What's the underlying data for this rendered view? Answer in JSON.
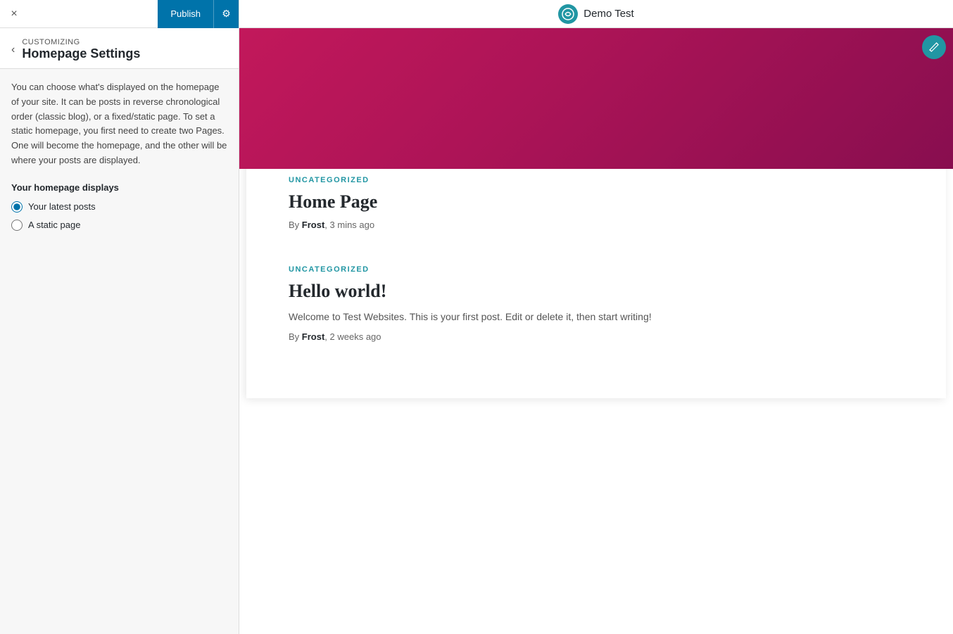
{
  "topbar": {
    "close_label": "×",
    "publish_label": "Publish",
    "settings_icon": "⚙"
  },
  "header": {
    "customizing_label": "Customizing",
    "section_title": "Homepage Settings",
    "back_icon": "‹"
  },
  "panel": {
    "description": "You can choose what's displayed on the homepage of your site. It can be posts in reverse chronological order (classic blog), or a fixed/static page. To set a static homepage, you first need to create two Pages. One will become the homepage, and the other will be where your posts are displayed.",
    "your_homepage_displays_label": "Your homepage displays",
    "options": [
      {
        "label": "Your latest posts",
        "value": "latest",
        "checked": true
      },
      {
        "label": "A static page",
        "value": "static",
        "checked": false
      }
    ]
  },
  "preview": {
    "site_logo_icon": "◎",
    "site_name": "Demo Test",
    "edit_icon": "✏"
  },
  "posts": [
    {
      "category": "UNCATEGORIZED",
      "title": "Home Page",
      "excerpt": "",
      "meta": "By",
      "author": "Frost",
      "time": ", 3 mins ago"
    },
    {
      "category": "UNCATEGORIZED",
      "title": "Hello world!",
      "excerpt": "Welcome to Test Websites. This is your first post. Edit or delete it, then start writing!",
      "meta": "By",
      "author": "Frost",
      "time": ", 2 weeks ago"
    }
  ]
}
